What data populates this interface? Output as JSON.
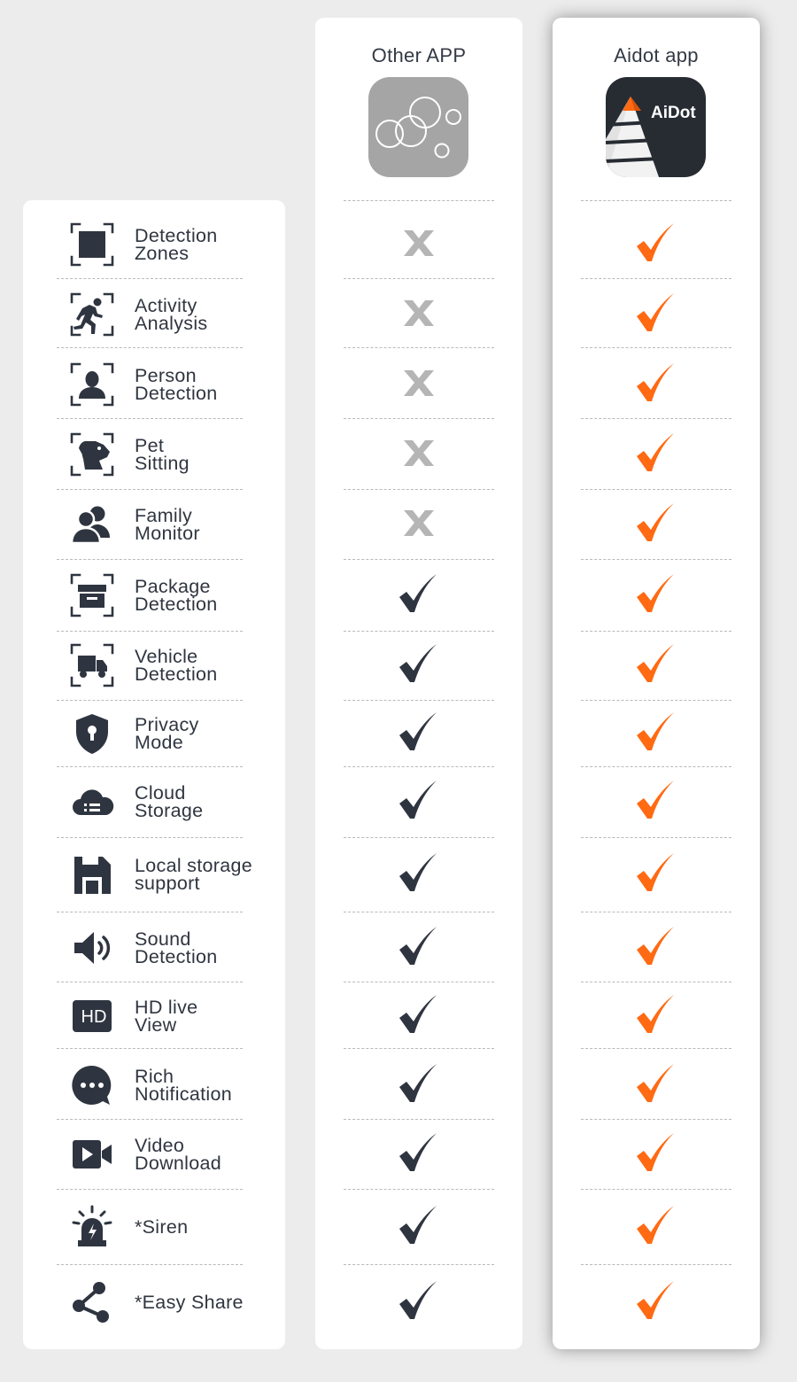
{
  "columns": {
    "other": {
      "title": "Other APP"
    },
    "aidot": {
      "title": "Aidot app",
      "logo_text": "AiDot"
    }
  },
  "colors": {
    "check_dark": "#2f3540",
    "check_orange": "#ff6a13",
    "cross": "#b5b5b5"
  },
  "features": [
    {
      "line1": "Detection",
      "line2": "Zones",
      "icon": "detection-zones-icon",
      "other": "cross",
      "aidot": "check"
    },
    {
      "line1": "Activity",
      "line2": "Analysis",
      "icon": "activity-analysis-icon",
      "other": "cross",
      "aidot": "check"
    },
    {
      "line1": "Person",
      "line2": "Detection",
      "icon": "person-detection-icon",
      "other": "cross",
      "aidot": "check"
    },
    {
      "line1": "Pet",
      "line2": "Sitting",
      "icon": "pet-sitting-icon",
      "other": "cross",
      "aidot": "check"
    },
    {
      "line1": "Family",
      "line2": "Monitor",
      "icon": "family-monitor-icon",
      "other": "cross",
      "aidot": "check"
    },
    {
      "line1": "Package",
      "line2": "Detection",
      "icon": "package-detection-icon",
      "other": "check",
      "aidot": "check"
    },
    {
      "line1": "Vehicle",
      "line2": "Detection",
      "icon": "vehicle-detection-icon",
      "other": "check",
      "aidot": "check"
    },
    {
      "line1": "Privacy",
      "line2": "Mode",
      "icon": "privacy-mode-icon",
      "other": "check",
      "aidot": "check"
    },
    {
      "line1": "Cloud",
      "line2": "Storage",
      "icon": "cloud-storage-icon",
      "other": "check",
      "aidot": "check"
    },
    {
      "line1": "Local storage",
      "line2": "support",
      "icon": "local-storage-icon",
      "other": "check",
      "aidot": "check"
    },
    {
      "line1": "Sound",
      "line2": "Detection",
      "icon": "sound-detection-icon",
      "other": "check",
      "aidot": "check"
    },
    {
      "line1": "HD live",
      "line2": "View",
      "icon": "hd-live-view-icon",
      "other": "check",
      "aidot": "check",
      "icon_text": "HD"
    },
    {
      "line1": "Rich",
      "line2": "Notification",
      "icon": "rich-notification-icon",
      "other": "check",
      "aidot": "check"
    },
    {
      "line1": "Video",
      "line2": "Download",
      "icon": "video-download-icon",
      "other": "check",
      "aidot": "check"
    },
    {
      "line1": "*Siren",
      "line2": "",
      "icon": "siren-icon",
      "other": "check",
      "aidot": "check"
    },
    {
      "line1": "*Easy Share",
      "line2": "",
      "icon": "easy-share-icon",
      "other": "check",
      "aidot": "check"
    }
  ]
}
